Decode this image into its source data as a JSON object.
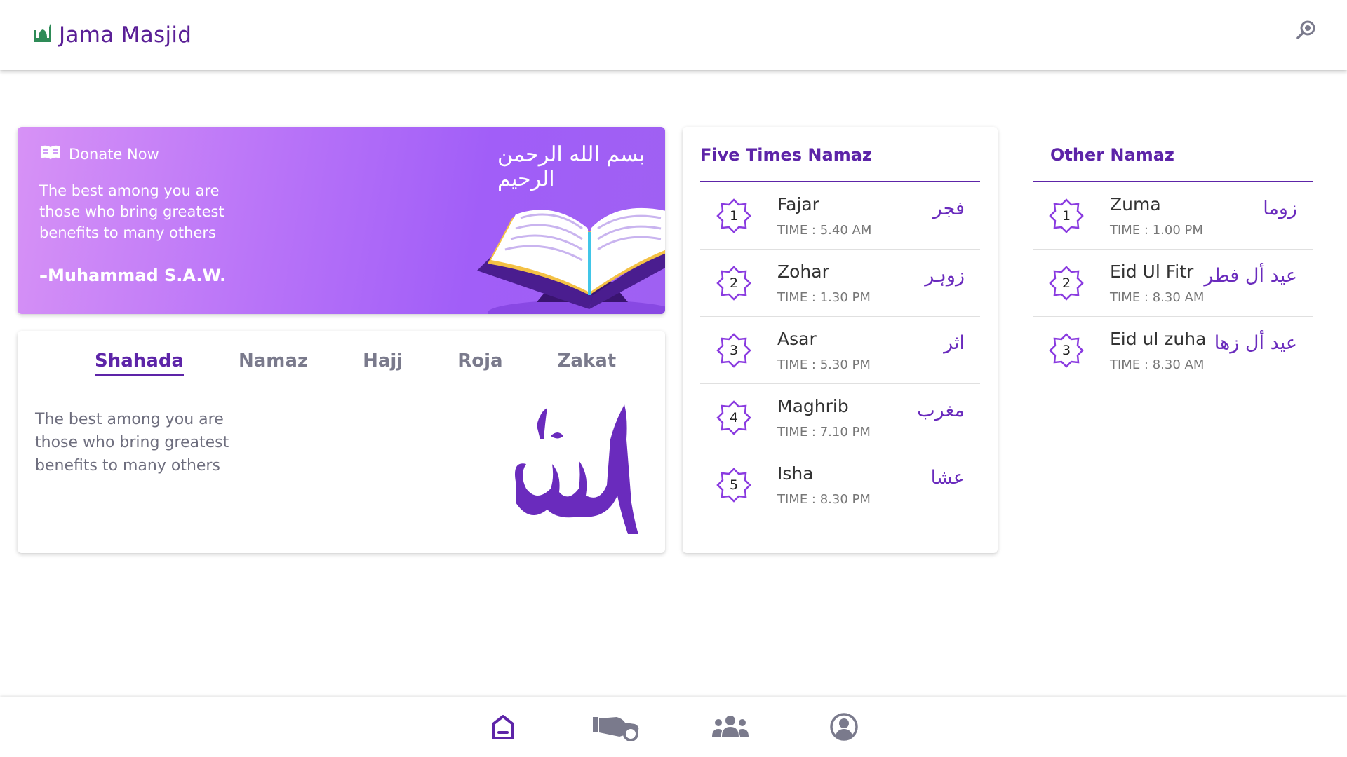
{
  "header": {
    "title": "Jama Masjid",
    "logo_icon": "mosque-icon",
    "search_icon": "search-icon"
  },
  "banner": {
    "donate_label": "Donate Now",
    "donate_icon": "book-icon",
    "quote": "The best among you are those who bring greatest benefits to many others",
    "author": "–Muhammad S.A.W.",
    "calligraphy": "بسم الله الرحمن الرحيم",
    "illustration": "quran-book-illustration"
  },
  "tabs": {
    "items": [
      {
        "label": "Shahada",
        "active": true
      },
      {
        "label": "Namaz",
        "active": false
      },
      {
        "label": "Hajj",
        "active": false
      },
      {
        "label": "Roja",
        "active": false
      },
      {
        "label": "Zakat",
        "active": false
      }
    ],
    "content_text": "The best among you are those who bring greatest benefits to many others",
    "calligraphy_icon": "allah-calligraphy"
  },
  "five_times": {
    "title": "Five Times Namaz",
    "items": [
      {
        "num": "1",
        "name": "Fajar",
        "time": "TIME : 5.40 AM",
        "arabic": "فجر"
      },
      {
        "num": "2",
        "name": "Zohar",
        "time": "TIME : 1.30 PM",
        "arabic": "زوہر"
      },
      {
        "num": "3",
        "name": "Asar",
        "time": "TIME : 5.30 PM",
        "arabic": "اثر"
      },
      {
        "num": "4",
        "name": "Maghrib",
        "time": "TIME : 7.10 PM",
        "arabic": "مغرب"
      },
      {
        "num": "5",
        "name": "Isha",
        "time": "TIME : 8.30 PM",
        "arabic": "عشا"
      }
    ]
  },
  "other": {
    "title": "Other Namaz",
    "items": [
      {
        "num": "1",
        "name": "Zuma",
        "time": "TIME : 1.00 PM",
        "arabic": "زوما"
      },
      {
        "num": "2",
        "name": "Eid Ul Fitr",
        "time": "TIME : 8.30 AM",
        "arabic": "عيد أل فطر"
      },
      {
        "num": "3",
        "name": "Eid ul zuha",
        "time": "TIME : 8.30 AM",
        "arabic": "عيد أل زها"
      }
    ]
  },
  "bottom_nav": {
    "items": [
      {
        "icon": "home-icon",
        "active": true
      },
      {
        "icon": "donate-hand-icon",
        "active": false
      },
      {
        "icon": "community-icon",
        "active": false
      },
      {
        "icon": "profile-icon",
        "active": false
      }
    ]
  },
  "colors": {
    "primary": "#5d24a8",
    "accent": "#6a2bbd",
    "banner_start": "#d792f6",
    "banner_end": "#9f60f2",
    "logo_green": "#2e8b57",
    "nav_gray": "#7a7a8c"
  }
}
